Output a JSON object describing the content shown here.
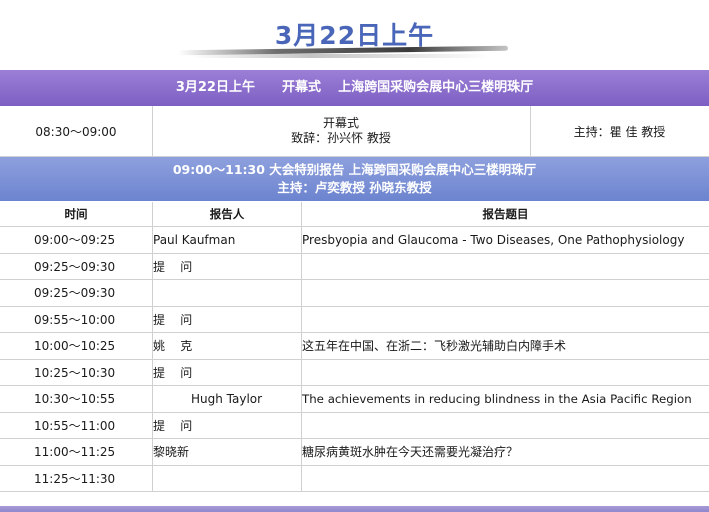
{
  "page_title": "3月22日上午",
  "opening": {
    "banner": [
      "3月22日上午",
      "开幕式",
      "上海跨国采购会展中心三楼明珠厅"
    ],
    "time": "08:30～09:00",
    "title": "开幕式",
    "speech": "致辞：孙兴怀 教授",
    "host": "主持：瞿 佳 教授"
  },
  "report": {
    "banner_line1": "09:00～11:30 大会特别报告  上海跨国采购会展中心三楼明珠厅",
    "banner_line2": "主持：卢奕教授  孙晓东教授"
  },
  "table": {
    "headers": [
      "时间",
      "报告人",
      "报告题目"
    ],
    "rows": [
      {
        "time": "09:00～09:25",
        "speaker": "Paul Kaufman",
        "topic": "Presbyopia and Glaucoma - Two Diseases, One Pathophysiology"
      },
      {
        "time": "09:25～09:30",
        "speaker": "提    问",
        "topic": ""
      },
      {
        "time": "09:25～09:30",
        "speaker": "",
        "topic": ""
      },
      {
        "time": "09:55～10:00",
        "speaker": "提    问",
        "topic": ""
      },
      {
        "time": "10:00～10:25",
        "speaker": "姚    克",
        "topic": "这五年在中国、在浙二：飞秒激光辅助白内障手术"
      },
      {
        "time": "10:25～10:30",
        "speaker": "提    问",
        "topic": ""
      },
      {
        "time": "10:30～10:55",
        "speaker": "Hugh Taylor",
        "topic": "The achievements in reducing blindness in the Asia Pacific Region"
      },
      {
        "time": "10:55～11:00",
        "speaker": "提    问",
        "topic": ""
      },
      {
        "time": "11:00～11:25",
        "speaker": "黎晓新",
        "topic": "糖尿病黄斑水肿在今天还需要光凝治疗？"
      },
      {
        "time": "11:25～11:30",
        "speaker": "",
        "topic": ""
      }
    ]
  }
}
